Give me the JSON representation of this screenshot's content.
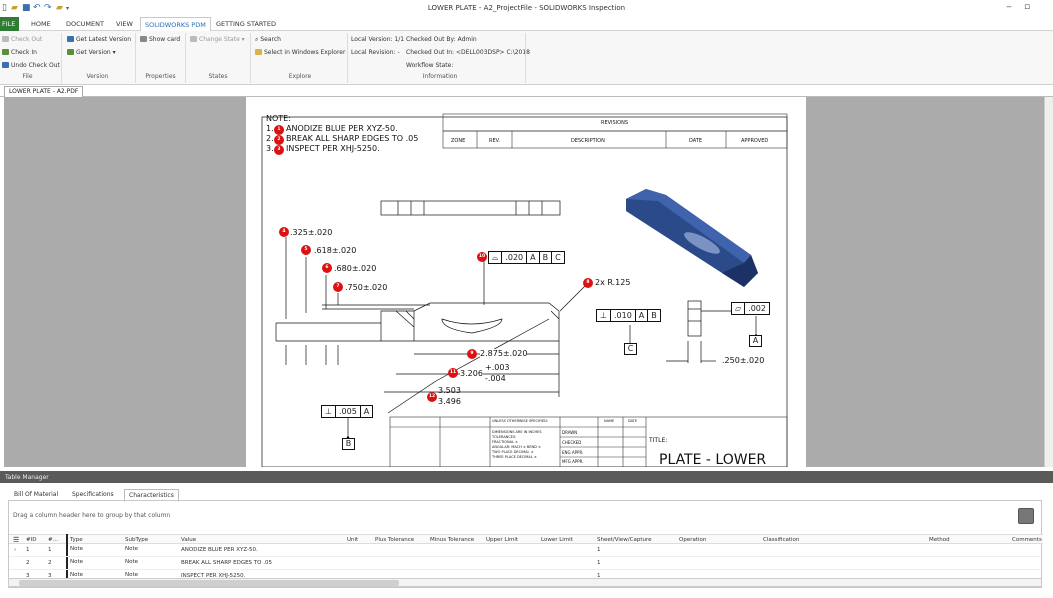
{
  "window": {
    "title": "LOWER PLATE - A2_ProjectFile - SOLIDWORKS Inspection",
    "minimize": "‒",
    "maximize": "▫"
  },
  "menu": {
    "file": "FILE",
    "tabs": [
      "HOME",
      "DOCUMENT",
      "VIEW",
      "SOLIDWORKS PDM",
      "GETTING STARTED"
    ]
  },
  "ribbon": {
    "check_out": "Check Out",
    "check_in": "Check In",
    "undo_check_out": "Undo Check Out",
    "get_latest_version": "Get Latest Version",
    "get_version": "Get Version ▾",
    "show_card": "Show card",
    "change_state": "Change State ▾",
    "search": "Search",
    "select_in_explorer": "Select in Windows Explorer",
    "local_version": "Local Version: 1/1",
    "local_revision": "Local Revision: -",
    "checked_out_by": "Checked Out By: Admin",
    "checked_out_in": "Checked Out In: <DELL003DSP> C:\\2018",
    "workflow_state": "Workflow State:",
    "groups": [
      "File",
      "Version",
      "Properties",
      "States",
      "Explore",
      "Information"
    ]
  },
  "document_tab": "LOWER PLATE - A2.PDF",
  "drawing": {
    "note_header": "NOTE:",
    "notes": [
      {
        "num": "1.",
        "text": "ANODIZE BLUE PER XYZ-50."
      },
      {
        "num": "2.",
        "text": "BREAK ALL SHARP EDGES TO .05"
      },
      {
        "num": "3.",
        "text": "INSPECT PER XHJ-5250."
      }
    ],
    "revisions_title": "REVISIONS",
    "revisions_cols": [
      "ZONE",
      "REV.",
      "DESCRIPTION",
      "DATE",
      "APPROVED"
    ],
    "dims": {
      "d4": ".325±.020",
      "d5": ".618±.020",
      "d6": ".680±.020",
      "d7": ".750±.020",
      "radius": "2x R.125",
      "d9": "2.875±.020",
      "d11_base": "3.206",
      "d11_plus": "+.003",
      "d11_minus": "-.004",
      "d12_upper": "3.503",
      "d12_lower": "3.496",
      "d250": ".250±.020"
    },
    "fcf_profile": [
      ".020",
      "A",
      "B",
      "C"
    ],
    "fcf_perp_right": [
      ".010",
      "A",
      "B"
    ],
    "fcf_flat": [
      ".002"
    ],
    "fcf_perp_left": [
      ".005",
      "A"
    ],
    "datums": {
      "c": "C",
      "a": "A",
      "b": "B"
    },
    "balloons": [
      "1",
      "2",
      "3",
      "4",
      "5",
      "6",
      "7",
      "8",
      "9",
      "10",
      "11",
      "12"
    ],
    "title_block": {
      "unless": "UNLESS OTHERWISE SPECIFIED:",
      "name": "NAME",
      "date": "DATE",
      "dims_inches": "DIMENSIONS ARE IN INCHES",
      "tolerances": "TOLERANCES:",
      "fractional": "FRACTIONAL ±",
      "angular": "ANGULAR: MACH ±   BEND ±",
      "two_place": "TWO PLACE DECIMAL   ±",
      "three_place": "THREE PLACE DECIMAL   ±",
      "drawn": "DRAWN",
      "checked": "CHECKED",
      "eng_appr": "ENG APPR.",
      "mfg_appr": "MFG APPR.",
      "title_label": "TITLE:",
      "part_title": "PLATE - LOWER"
    }
  },
  "table_manager": {
    "title": "Table Manager",
    "tabs": [
      "Bill Of Material",
      "Specifications",
      "Characteristics"
    ],
    "group_hint": "Drag a column header here to group by that column",
    "columns": [
      "#ID",
      "#...",
      "Type",
      "SubType",
      "Value",
      "Unit",
      "Plus Tolerance",
      "Minus Tolerance",
      "Upper Limit",
      "Lower Limit",
      "Sheet/View/Capture",
      "Operation",
      "Classification",
      "Method",
      "Comments"
    ],
    "rows": [
      {
        "id": "1",
        "num": "1",
        "type": "Note",
        "subtype": "Note",
        "value": "ANODIZE BLUE PER XYZ-50.",
        "sheet": "1"
      },
      {
        "id": "2",
        "num": "2",
        "type": "Note",
        "subtype": "Note",
        "value": "BREAK ALL SHARP EDGES TO .05",
        "sheet": "1"
      },
      {
        "id": "3",
        "num": "3",
        "type": "Note",
        "subtype": "Note",
        "value": "INSPECT PER XHJ-5250.",
        "sheet": "1"
      }
    ]
  }
}
